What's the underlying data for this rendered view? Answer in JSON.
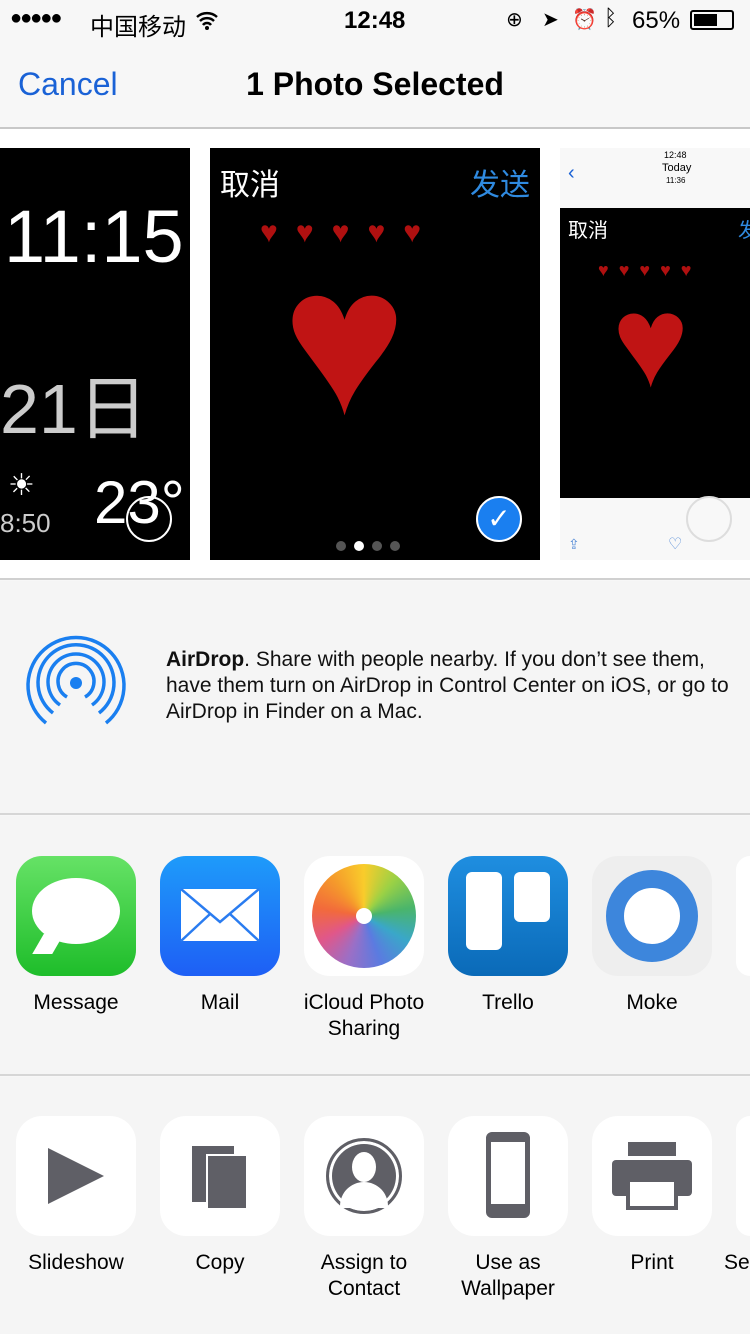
{
  "status": {
    "signal": "●●●●●",
    "carrier": "中国移动",
    "time": "12:48",
    "battery": "65%"
  },
  "nav": {
    "cancel": "Cancel",
    "title": "1 Photo Selected"
  },
  "photos": [
    {
      "time": "11:15",
      "date": "21日",
      "small_time": "8:50",
      "temp": "23°",
      "selected": false
    },
    {
      "left_text": "取消",
      "right_text": "发送",
      "selected": true
    },
    {
      "status_time": "12:48",
      "title": "Today",
      "subtitle": "11:36",
      "left_text": "取消",
      "right_text": "发",
      "selected": false
    }
  ],
  "airdrop": {
    "title": "AirDrop",
    "text": ". Share with people nearby. If you don’t see them, have them turn on AirDrop in Control Center on iOS, or go to AirDrop in Finder on a Mac.",
    "color": "#1a7ff0"
  },
  "apps": [
    {
      "label": "Message",
      "icon": "message-icon"
    },
    {
      "label": "Mail",
      "icon": "mail-icon"
    },
    {
      "label": "iCloud Photo Sharing",
      "icon": "photos-icon"
    },
    {
      "label": "Trello",
      "icon": "trello-icon"
    },
    {
      "label": "Moke",
      "icon": "moke-icon"
    }
  ],
  "actions": [
    {
      "label": "Slideshow",
      "icon": "play-icon"
    },
    {
      "label": "Copy",
      "icon": "copy-icon"
    },
    {
      "label": "Assign to Contact",
      "icon": "contact-icon"
    },
    {
      "label": "Use as Wallpaper",
      "icon": "phone-icon"
    },
    {
      "label": "Print",
      "icon": "printer-icon"
    },
    {
      "label": "Se",
      "icon": "more-icon"
    }
  ],
  "colors": {
    "accent": "#1a62d6",
    "selected": "#1a7ff0"
  }
}
